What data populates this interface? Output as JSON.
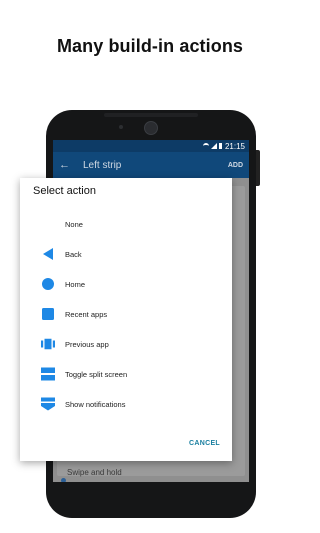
{
  "headline": "Many build-in actions",
  "status_bar": {
    "time": "21:15"
  },
  "app_bar": {
    "title": "Left strip",
    "action": "ADD"
  },
  "background": {
    "list_item": "Swipe and hold"
  },
  "dialog": {
    "title": "Select action",
    "options": [
      {
        "label": "None",
        "icon": "none"
      },
      {
        "label": "Back",
        "icon": "back-triangle-icon"
      },
      {
        "label": "Home",
        "icon": "home-circle-icon"
      },
      {
        "label": "Recent apps",
        "icon": "recent-square-icon"
      },
      {
        "label": "Previous app",
        "icon": "previous-app-icon"
      },
      {
        "label": "Toggle split screen",
        "icon": "split-screen-icon"
      },
      {
        "label": "Show notifications",
        "icon": "notifications-pulldown-icon"
      }
    ],
    "cancel": "CANCEL"
  },
  "colors": {
    "accent": "#1e88e5",
    "appbar": "#10487a",
    "statusbar": "#0d3b66",
    "cancel": "#1a7fa0"
  }
}
